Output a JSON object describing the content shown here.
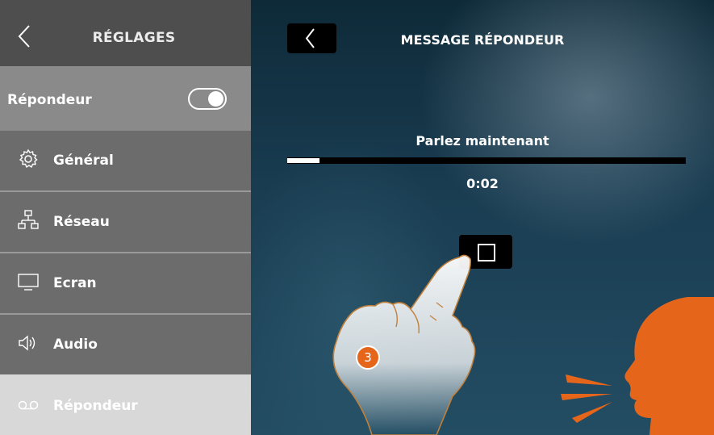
{
  "sidebar": {
    "title": "RÉGLAGES",
    "toggle_row": {
      "label": "Répondeur",
      "toggle_on": true
    },
    "items": [
      {
        "label": "Général",
        "icon": "gear-icon"
      },
      {
        "label": "Réseau",
        "icon": "network-icon"
      },
      {
        "label": "Ecran",
        "icon": "monitor-icon"
      },
      {
        "label": "Audio",
        "icon": "speaker-icon"
      },
      {
        "label": "Répondeur",
        "icon": "voicemail-icon",
        "active": true
      }
    ]
  },
  "main": {
    "title": "MESSAGE RÉPONDEUR",
    "prompt": "Parlez maintenant",
    "timer": "0:02",
    "recording_progress_percent": 8,
    "step_badge": "3"
  },
  "colors": {
    "accent_orange": "#e5661b",
    "sidebar_dark": "#4e4e4e",
    "sidebar_item": "#6c6c6c",
    "sidebar_active": "#d8d8d8"
  }
}
